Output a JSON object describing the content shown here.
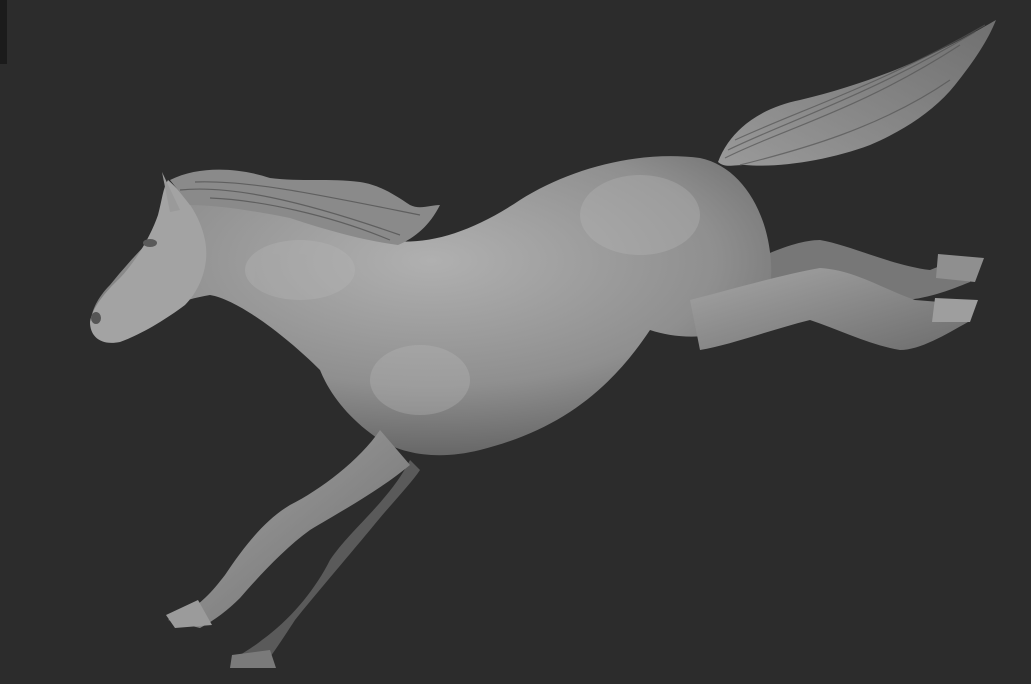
{
  "viewport": {
    "background_color": "#2c2c2c",
    "model_color": "#8e8e8e",
    "model_highlight": "#b4b4b4",
    "model_shadow": "#4a4a4a"
  },
  "model": {
    "subject": "horse-sculpt",
    "pose": "leaping"
  }
}
